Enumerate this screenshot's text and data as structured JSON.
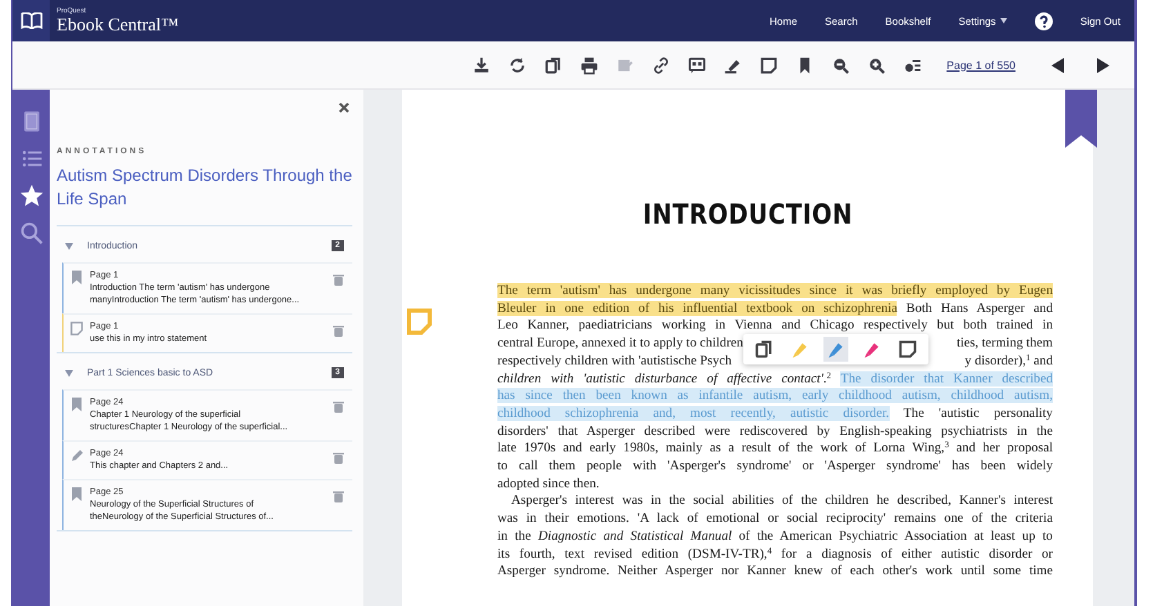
{
  "brand": {
    "small": "ProQuest",
    "name": "Ebook Central™"
  },
  "nav": [
    {
      "label": "Home",
      "kind": "link"
    },
    {
      "label": "Search",
      "kind": "link"
    },
    {
      "label": "Bookshelf",
      "kind": "link"
    },
    {
      "label": "Settings",
      "kind": "menu"
    },
    {
      "kind": "help"
    },
    {
      "label": "Sign Out",
      "kind": "link"
    }
  ],
  "toolbar": [
    {
      "kind": "download",
      "disabled": false
    },
    {
      "kind": "sync",
      "disabled": false
    },
    {
      "kind": "copy",
      "disabled": false
    },
    {
      "kind": "print",
      "disabled": false
    },
    {
      "kind": "export",
      "disabled": true
    },
    {
      "kind": "link",
      "disabled": false
    },
    {
      "kind": "cite",
      "disabled": false
    },
    {
      "kind": "highlight",
      "disabled": false
    },
    {
      "kind": "note",
      "disabled": false
    },
    {
      "kind": "bookmark",
      "disabled": false
    },
    {
      "kind": "zoom-out",
      "disabled": false
    },
    {
      "kind": "zoom-in",
      "disabled": false
    },
    {
      "kind": "view",
      "disabled": false
    }
  ],
  "page_indicator": "Page 1 of 550",
  "rail": [
    {
      "kind": "book",
      "selected": false
    },
    {
      "kind": "list",
      "selected": false
    },
    {
      "kind": "star",
      "selected": true
    },
    {
      "kind": "search",
      "selected": false
    }
  ],
  "annotations": {
    "heading": "ANNOTATIONS",
    "book_title": "Autism Spectrum Disorders Through the Life Span",
    "sections": [
      {
        "title": "Introduction",
        "count": "2",
        "expanded": true,
        "items": [
          {
            "kind": "highlight",
            "page": "Page 1",
            "text": "Introduction The term 'autism' has undergone manyIntroduction The term 'autism' has undergone..."
          },
          {
            "kind": "note",
            "page": "Page 1",
            "text": "use this in my intro statement"
          }
        ]
      },
      {
        "title": "Part 1 Sciences basic to ASD",
        "count": "3",
        "expanded": true,
        "items": [
          {
            "kind": "highlight",
            "page": "Page 24",
            "text": "Chapter 1 Neurology of the superficial structuresChapter 1 Neurology of the superficial..."
          },
          {
            "kind": "pen",
            "page": "Page 24",
            "text": "This chapter and Chapters 2 and..."
          },
          {
            "kind": "highlight",
            "page": "Page 25",
            "text": "Neurology of the Superficial Structures of theNeurology of the Superficial Structures of..."
          }
        ]
      }
    ]
  },
  "page": {
    "heading": "INTRODUCTION",
    "bookmarked": true,
    "note_marker": true,
    "lines": [
      {
        "kind": "justified",
        "segments": [
          {
            "kind": "yellow",
            "text": "The term 'autism' has undergone many vicissitudes since it was briefly employed by Eugen"
          }
        ]
      },
      {
        "kind": "justified",
        "segments": [
          {
            "kind": "yellow",
            "text": "Bleuler in one edition of his influential textbook on schizophrenia"
          },
          {
            "kind": "plain",
            "text": " Both Hans Asperger and"
          }
        ]
      },
      {
        "kind": "justified",
        "segments": [
          {
            "kind": "plain",
            "text": "Leo Kanner, paediatricians working in Vienna and Chicago respectively but both trained in"
          }
        ]
      },
      {
        "kind": "split",
        "segments": [
          {
            "kind": "plain",
            "text": "central Europe, annexed it to apply to children"
          },
          {
            "kind": "plain",
            "text": "ties, terming them"
          }
        ]
      },
      {
        "kind": "split",
        "segments": [
          {
            "kind": "plain",
            "text": "respectively children with 'autistische Psych"
          },
          {
            "kind": "plain",
            "text": "y disorder),$^{1}$ and"
          }
        ]
      },
      {
        "kind": "justified",
        "segments": [
          {
            "kind": "plain",
            "text": "*children with 'autistic disturbance of affective contact'*.$^{2}$ "
          },
          {
            "kind": "blue",
            "text": "The disorder that Kanner described"
          }
        ]
      },
      {
        "kind": "justified",
        "segments": [
          {
            "kind": "blue",
            "text": "has since then been known as infantile autism, early childhood autism, childhood autism,"
          }
        ]
      },
      {
        "kind": "justified",
        "segments": [
          {
            "kind": "blue",
            "text": "childhood schizophrenia and, most recently, autistic disorder."
          },
          {
            "kind": "plain",
            "text": " The 'autistic personality"
          }
        ]
      },
      {
        "kind": "justified",
        "segments": [
          {
            "kind": "plain",
            "text": "disorders' that Asperger described were rediscovered by English-speaking psychiatrists in the"
          }
        ]
      },
      {
        "kind": "justified",
        "segments": [
          {
            "kind": "plain",
            "text": "late 1970s and early 1980s, mainly as a result of the work of Lorna Wing,$^{3}$ and her proposal"
          }
        ]
      },
      {
        "kind": "justified",
        "segments": [
          {
            "kind": "plain",
            "text": "to call them people with 'Asperger's syndrome' or 'Asperger syndrome' has been widely"
          }
        ]
      },
      {
        "kind": "last",
        "segments": [
          {
            "kind": "plain",
            "text": "adopted since then."
          }
        ]
      },
      {
        "kind": "indent",
        "segments": [
          {
            "kind": "plain",
            "text": "Asperger's interest was in the social abilities of the children he described, Kanner's interest"
          }
        ]
      },
      {
        "kind": "justified",
        "segments": [
          {
            "kind": "plain",
            "text": "was in their emotions. 'A lack of emotional or social reciprocity' remains one of the criteria"
          }
        ]
      },
      {
        "kind": "justified",
        "segments": [
          {
            "kind": "plain",
            "text": "in the *Diagnostic and Statistical Manual* of the American Psychiatric Association at least up to"
          }
        ]
      },
      {
        "kind": "justified",
        "segments": [
          {
            "kind": "plain",
            "text": "its fourth, text revised edition (DSM-IV-TR),$^{4}$ for a diagnosis of either autistic disorder or"
          }
        ]
      },
      {
        "kind": "justified",
        "segments": [
          {
            "kind": "plain",
            "text": "Asperger syndrome. Neither Asperger nor Kanner knew of each other's work until some time"
          }
        ]
      }
    ],
    "popup": [
      {
        "kind": "copy",
        "selected": false
      },
      {
        "kind": "highlighter",
        "color": "#f5c84a",
        "selected": false
      },
      {
        "kind": "highlighter",
        "color": "#3f8fd6",
        "selected": true
      },
      {
        "kind": "highlighter",
        "color": "#e8327c",
        "selected": false
      },
      {
        "kind": "note",
        "selected": false
      }
    ]
  }
}
